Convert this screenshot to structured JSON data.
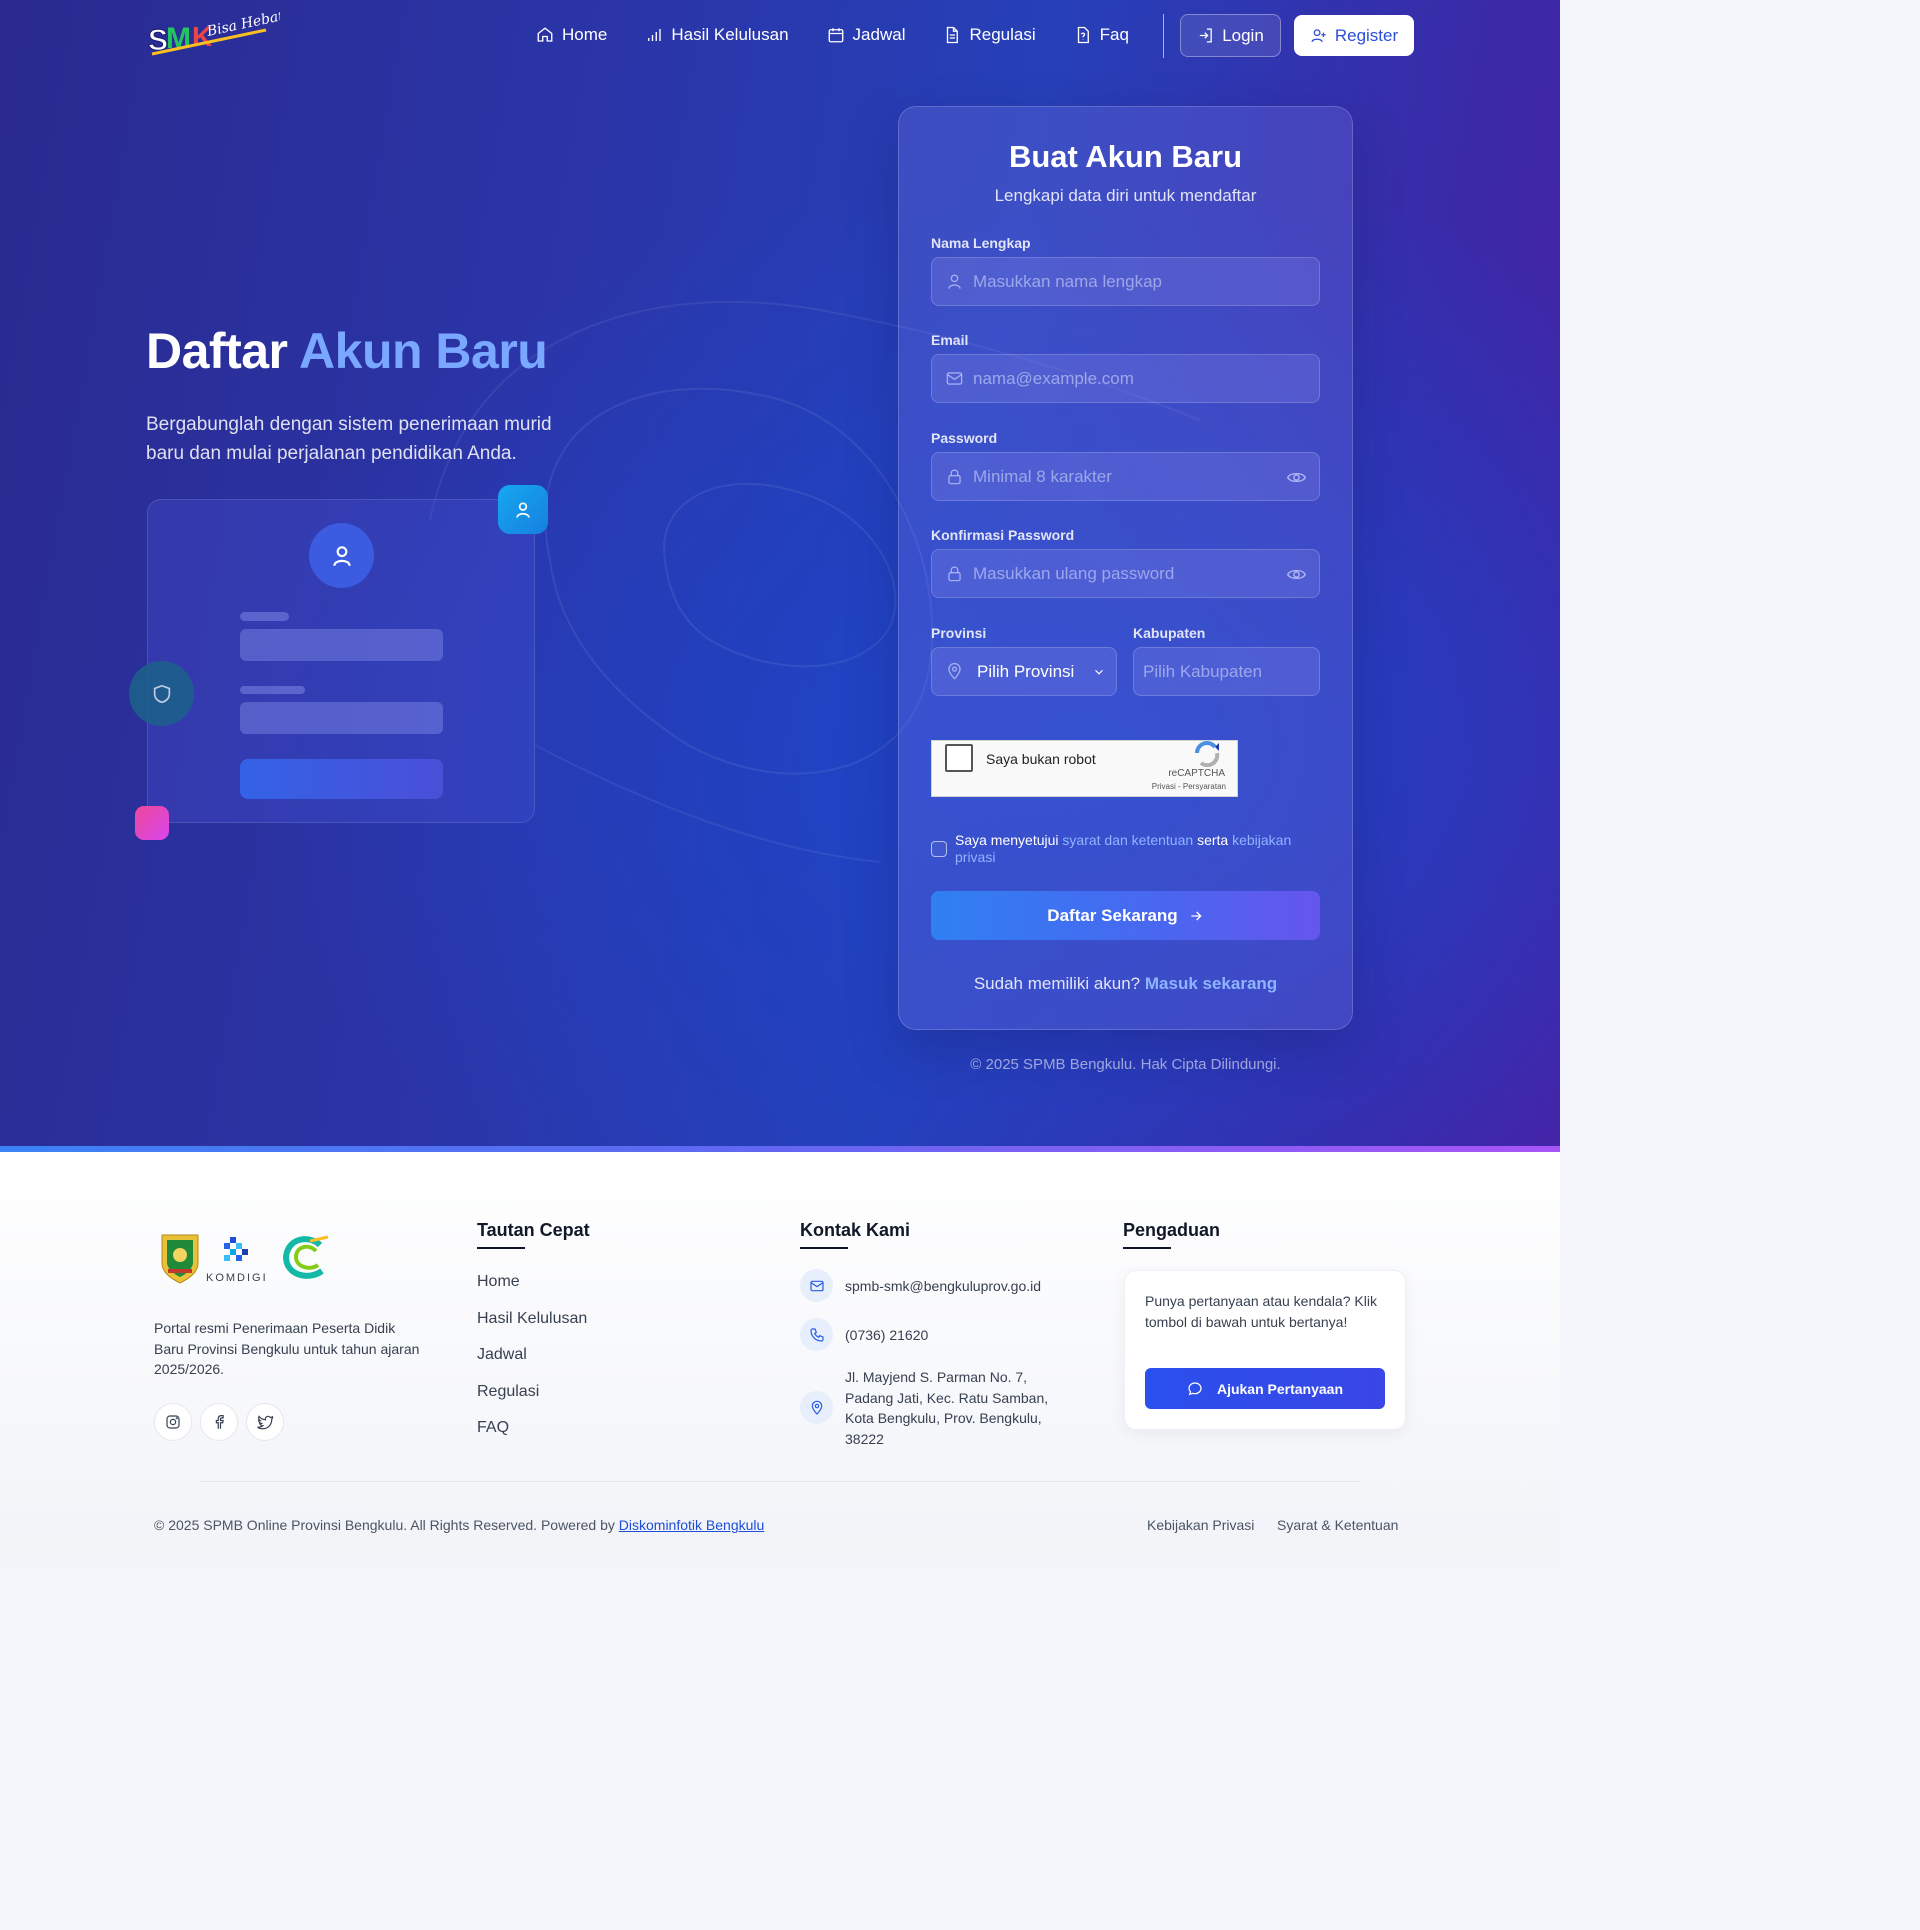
{
  "nav": {
    "logo_name": "SMK Bisa Hebat",
    "items": [
      {
        "label": "Home",
        "icon": "home-icon"
      },
      {
        "label": "Hasil Kelulusan",
        "icon": "bar-chart-icon"
      },
      {
        "label": "Jadwal",
        "icon": "calendar-icon"
      },
      {
        "label": "Regulasi",
        "icon": "document-icon"
      },
      {
        "label": "Faq",
        "icon": "question-file-icon"
      }
    ],
    "login_label": "Login",
    "register_label": "Register"
  },
  "hero": {
    "title_part1": "Daftar",
    "title_part2": "Akun Baru",
    "description": "Bergabunglah dengan sistem penerimaan murid baru dan mulai perjalanan pendidikan Anda."
  },
  "form": {
    "title": "Buat Akun Baru",
    "subtitle": "Lengkapi data diri untuk mendaftar",
    "name_label": "Nama Lengkap",
    "name_placeholder": "Masukkan nama lengkap",
    "email_label": "Email",
    "email_placeholder": "nama@example.com",
    "password_label": "Password",
    "password_placeholder": "Minimal 8 karakter",
    "confirm_label": "Konfirmasi Password",
    "confirm_placeholder": "Masukkan ulang password",
    "province_label": "Provinsi",
    "province_value": "Pilih Provinsi",
    "regency_label": "Kabupaten",
    "regency_placeholder": "Pilih Kabupaten",
    "recaptcha": {
      "label": "Saya bukan robot",
      "brand": "reCAPTCHA",
      "links": "Privasi - Persyaratan"
    },
    "agree_prefix": "Saya menyetujui",
    "agree_terms": "syarat dan ketentuan",
    "agree_mid": "serta",
    "agree_privacy": "kebijakan privasi",
    "submit_label": "Daftar Sekarang",
    "have_account": "Sudah memiliki akun?",
    "login_link": "Masuk sekarang",
    "copyright": "© 2025 SPMB Bengkulu. Hak Cipta Dilindungi."
  },
  "footer": {
    "logo_text": "KOMDIGI",
    "about": "Portal resmi Penerimaan Peserta Didik Baru Provinsi Bengkulu untuk tahun ajaran 2025/2026.",
    "quick_links_title": "Tautan Cepat",
    "quick_links": [
      "Home",
      "Hasil Kelulusan",
      "Jadwal",
      "Regulasi",
      "FAQ"
    ],
    "contact_title": "Kontak Kami",
    "contact_email": "spmb-smk@bengkuluprov.go.id",
    "contact_phone": "(0736) 21620",
    "contact_address": "Jl. Mayjend S. Parman No. 7, Padang Jati, Kec. Ratu Samban, Kota Bengkulu, Prov. Bengkulu, 38222",
    "complaint_title": "Pengaduan",
    "complaint_text": "Punya pertanyaan atau kendala? Klik tombol di bawah untuk bertanya!",
    "complaint_button": "Ajukan Pertanyaan",
    "copyright_prefix": "© 2025 SPMB Online Provinsi Bengkulu. All Rights Reserved. Powered by",
    "copyright_link": "Diskominfotik Bengkulu",
    "privacy_link": "Kebijakan Privasi",
    "terms_link": "Syarat & Ketentuan"
  },
  "colors": {
    "accent": "#7aa7ff",
    "primary_button": "#2f80f2",
    "register_text": "#2b4fd6",
    "link": "#8fb4ff"
  }
}
